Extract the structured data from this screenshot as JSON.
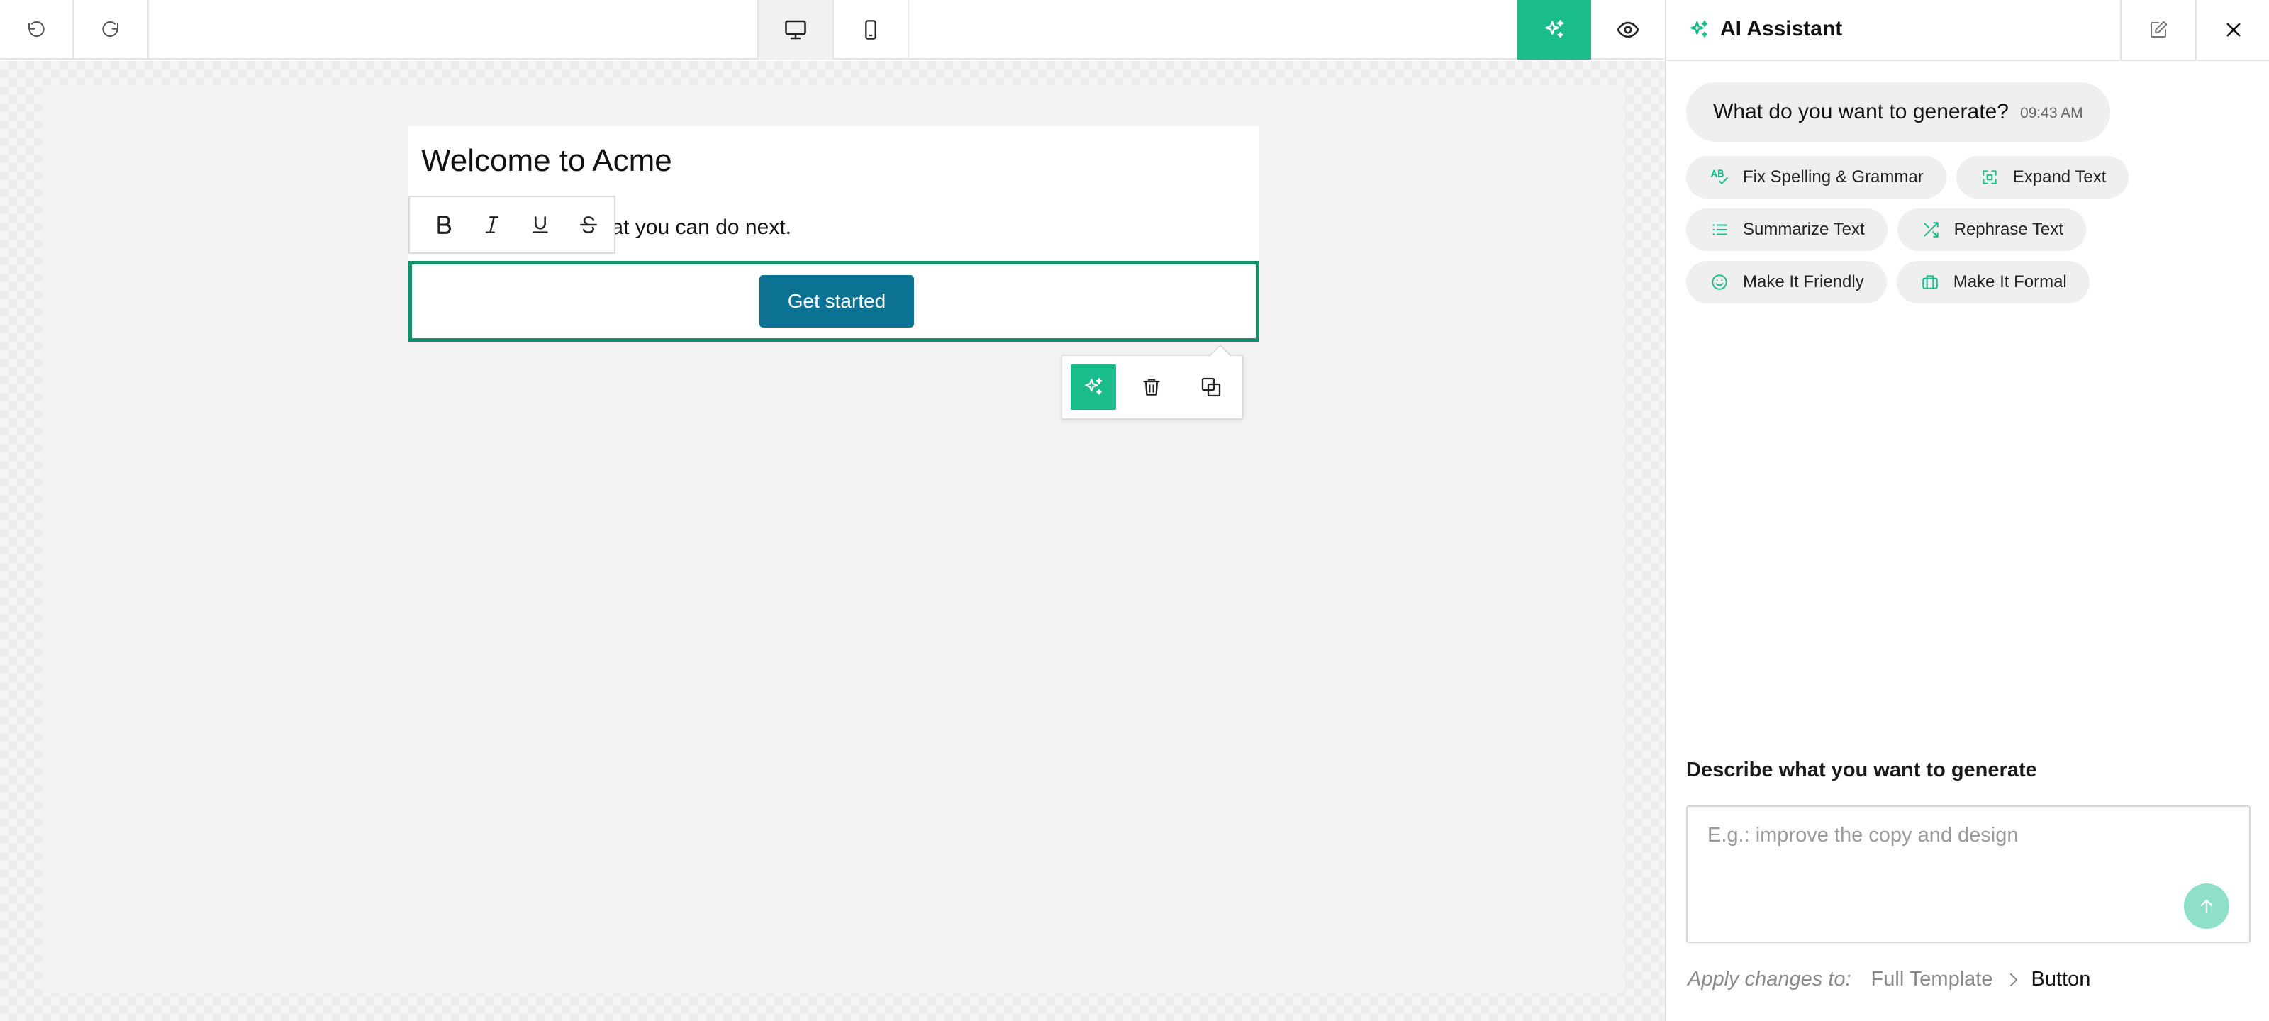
{
  "toolbar": {
    "undo_icon": "undo-icon",
    "redo_icon": "redo-icon",
    "desktop_icon": "desktop-icon",
    "mobile_icon": "mobile-icon",
    "ai_icon": "sparkles-icon",
    "preview_icon": "eye-icon",
    "accent_color": "#1abc8c"
  },
  "canvas": {
    "email_title": "Welcome to Acme",
    "email_body": "Hi there - here is what you can do next.",
    "cta_label": "Get started",
    "cta_color": "#0b7293",
    "selection_color": "#138f6c",
    "format_buttons": [
      "bold-icon",
      "italic-icon",
      "underline-icon",
      "strikethrough-icon"
    ],
    "block_actions": [
      "sparkles-icon",
      "trash-icon",
      "duplicate-icon"
    ]
  },
  "assistant": {
    "title": "AI Assistant",
    "message": "What do you want to generate?",
    "message_time": "09:43 AM",
    "chips": [
      {
        "label": "Fix Spelling & Grammar",
        "icon": "spellcheck-icon"
      },
      {
        "label": "Expand Text",
        "icon": "expand-icon"
      },
      {
        "label": "Summarize Text",
        "icon": "list-icon"
      },
      {
        "label": "Rephrase Text",
        "icon": "shuffle-icon"
      },
      {
        "label": "Make It Friendly",
        "icon": "smile-icon"
      },
      {
        "label": "Make It Formal",
        "icon": "briefcase-icon"
      }
    ],
    "prompt_label": "Describe what you want to generate",
    "prompt_placeholder": "E.g.: improve the copy and design",
    "prompt_value": "",
    "apply_label": "Apply changes to:",
    "apply_full": "Full Template",
    "apply_target": "Button"
  }
}
